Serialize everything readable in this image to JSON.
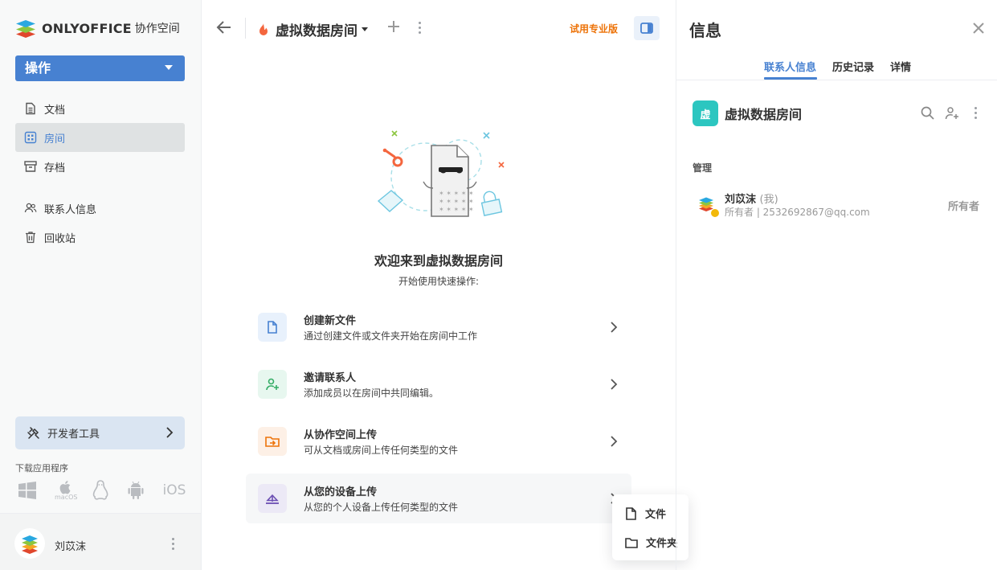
{
  "app": {
    "brand": "ONLYOFFICE",
    "product": "协作空间"
  },
  "sidebar": {
    "action_label": "操作",
    "items": [
      {
        "label": "文档",
        "icon": "document-icon"
      },
      {
        "label": "房间",
        "icon": "rooms-icon",
        "active": true
      },
      {
        "label": "存档",
        "icon": "archive-icon"
      },
      {
        "label": "联系人信息",
        "icon": "contacts-icon"
      },
      {
        "label": "回收站",
        "icon": "trash-icon"
      }
    ],
    "dev_tools_label": "开发者工具",
    "download_label": "下载应用程序",
    "apps": {
      "macos": "macOS",
      "ios": "iOS"
    },
    "user_name": "刘苡沫"
  },
  "header": {
    "room_title": "虚拟数据房间",
    "trial_label": "试用专业版"
  },
  "main": {
    "welcome_title": "欢迎来到虚拟数据房间",
    "welcome_subtitle": "开始使用快速操作:",
    "quick_actions": [
      {
        "title": "创建新文件",
        "desc": "通过创建文件或文件夹开始在房间中工作"
      },
      {
        "title": "邀请联系人",
        "desc": "添加成员以在房间中共同编辑。"
      },
      {
        "title": "从协作空间上传",
        "desc": "可从文档或房间上传任何类型的文件"
      },
      {
        "title": "从您的设备上传",
        "desc": "从您的个人设备上传任何类型的文件"
      }
    ],
    "upload_menu": {
      "file": "文件",
      "folder": "文件夹"
    }
  },
  "info_panel": {
    "title": "信息",
    "tabs": [
      "联系人信息",
      "历史记录",
      "详情"
    ],
    "room_avatar_text": "虚",
    "room_name": "虚拟数据房间",
    "section_label": "管理",
    "member": {
      "name": "刘苡沫",
      "me_tag": "(我)",
      "subtitle": "所有者 | 2532692867@qq.com",
      "role": "所有者"
    }
  },
  "colors": {
    "accent": "#4781d1",
    "trial": "#ed7309",
    "room_avatar": "#2cc6c0"
  }
}
